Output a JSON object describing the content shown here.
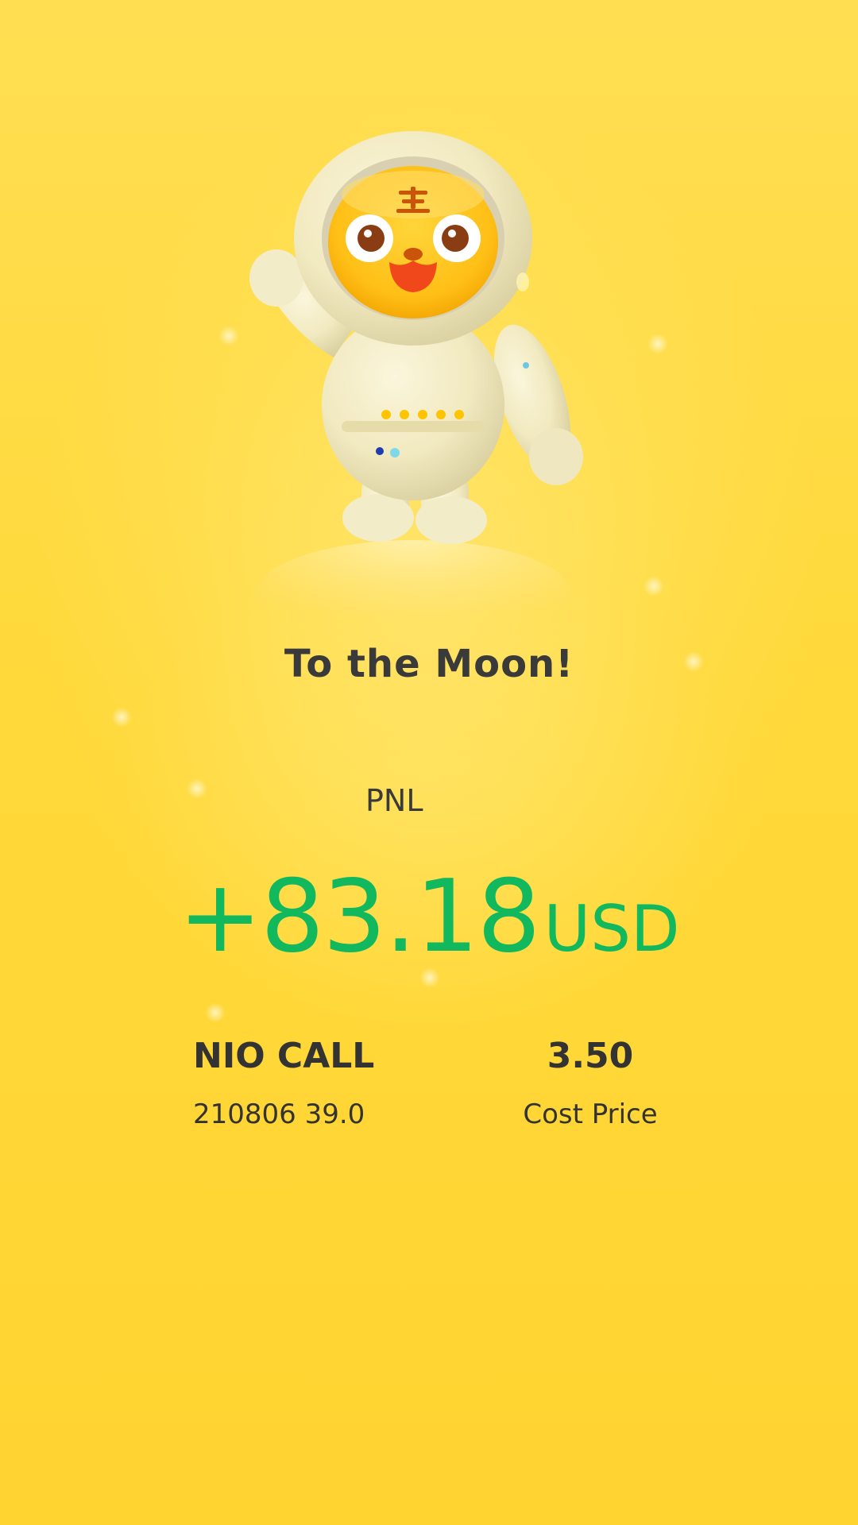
{
  "card": {
    "title": "To the Moon!",
    "pnl_label": "PNL",
    "pnl_value": "+83.18",
    "pnl_currency": "USD",
    "pnl_color": "#12b85e",
    "background_color": "#ffd93a"
  },
  "position": {
    "symbol": "NIO CALL",
    "contract": "210806 39.0",
    "cost_price": "3.50",
    "cost_price_label": "Cost Price"
  },
  "illustration": {
    "icon": "tiger-astronaut-mascot"
  }
}
